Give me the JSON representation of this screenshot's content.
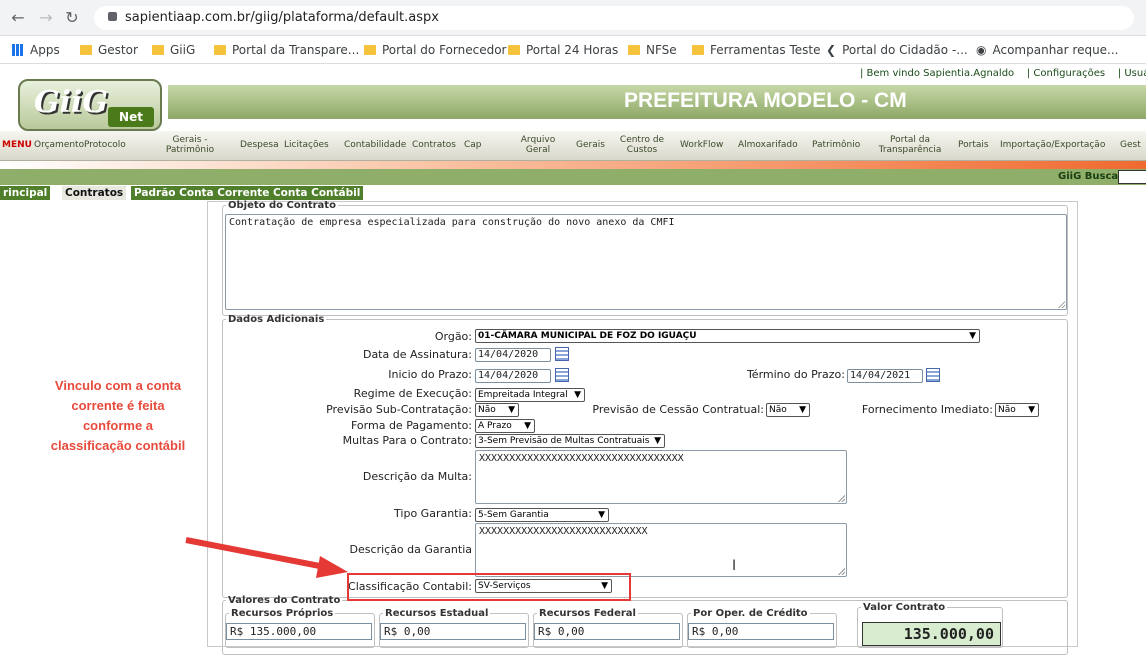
{
  "browser": {
    "url": "sapientiaap.com.br/giig/plataforma/default.aspx",
    "bookmarks": [
      "Apps",
      "Gestor",
      "GiiG",
      "Portal da Transpare...",
      "Portal do Fornecedor",
      "Portal 24 Horas",
      "NFSe",
      "Ferramentas Teste",
      "Portal do Cidadão -...",
      "Acompanhar reque..."
    ]
  },
  "header": {
    "welcome": "| Bem vindo Sapientia.Agnaldo",
    "config": "| Configurações",
    "user": "| Usuári",
    "logo_main": "GiiG",
    "logo_sub": "Net",
    "title": "PREFEITURA MODELO - CM"
  },
  "menu": {
    "menu_label": "MENU",
    "items": [
      "Orçamento",
      "Protocolo",
      "Gerais - Patrimônio",
      "Despesa",
      "Licitações",
      "Contabilidade",
      "Contratos",
      "Cap",
      "Arquivo Geral",
      "Gerais",
      "Centro de Custos",
      "WorkFlow",
      "Almoxarifado",
      "Patrimônio",
      "Portal da Transparência",
      "Portais",
      "Importação/Exportação",
      "Gest"
    ]
  },
  "search": {
    "label": "GiiG Busca:"
  },
  "tabs": [
    "rincipal",
    "Contratos",
    "Padrão Conta Corrente Conta Contábil"
  ],
  "objeto": {
    "legend": "Objeto do Contrato",
    "text": "Contratação de empresa especializada para construção do novo anexo da CMFI"
  },
  "dados": {
    "legend": "Dados Adicionais",
    "orgao_label": "Orgão:",
    "orgao": "01-CÂMARA MUNICIPAL DE FOZ DO IGUAÇU",
    "assinatura_label": "Data de Assinatura:",
    "assinatura": "14/04/2020",
    "inicio_label": "Inicio do Prazo:",
    "inicio": "14/04/2020",
    "termino_label": "Término do Prazo:",
    "termino": "14/04/2021",
    "regime_label": "Regime de Execução:",
    "regime": "Empreitada Integral",
    "sub_label": "Previsão Sub-Contratação:",
    "sub": "Não",
    "cessao_label": "Previsão de Cessão Contratual:",
    "cessao": "Não",
    "fornec_label": "Fornecimento Imediato:",
    "fornec": "Não",
    "pagamento_label": "Forma de Pagamento:",
    "pagamento": "A Prazo",
    "multas_label": "Multas Para o Contrato:",
    "multas": "3-Sem Previsão de Multas Contratuais",
    "desc_multa_label": "Descrição da Multa:",
    "desc_multa": "XXXXXXXXXXXXXXXXXXXXXXXXXXXXXXXXXX",
    "garantia_label": "Tipo Garantia:",
    "garantia": "5-Sem Garantia",
    "desc_garantia_label": "Descrição da Garantia",
    "desc_garantia": "XXXXXXXXXXXXXXXXXXXXXXXXXXXX",
    "classif_label": "Classificação Contabil:",
    "classif": "SV-Serviços"
  },
  "annotation": "Vinculo com a conta corrente é feita conforme a classificação contábil",
  "valores": {
    "legend": "Valores do Contrato",
    "proprios_label": "Recursos Próprios",
    "proprios": "R$ 135.000,00",
    "estadual_label": "Recursos Estadual",
    "estadual": "R$ 0,00",
    "federal_label": "Recursos Federal",
    "federal": "R$ 0,00",
    "credito_label": "Por Oper. de Crédito",
    "credito": "R$ 0,00",
    "total_label": "Valor Contrato",
    "total": "135.000,00"
  },
  "colors": {
    "accent": "#4f7f2a",
    "highlight": "#e53935"
  }
}
